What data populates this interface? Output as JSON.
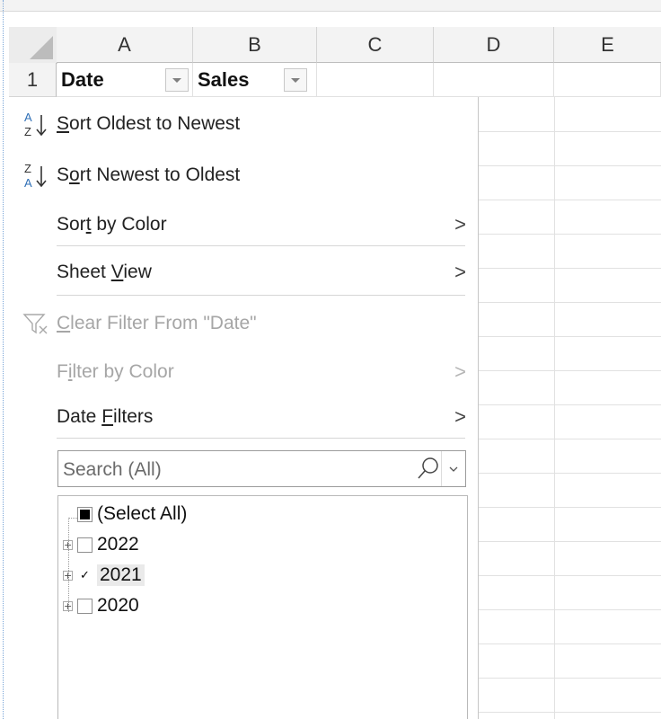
{
  "columns": [
    "A",
    "B",
    "C",
    "D",
    "E"
  ],
  "row_number": "1",
  "cells": {
    "a1": "Date",
    "b1": "Sales"
  },
  "menu": {
    "sort_asc": {
      "prefix": "",
      "mnemonic": "S",
      "rest": "ort Oldest to Newest",
      "icon_top": "A",
      "icon_bottom": "Z"
    },
    "sort_desc": {
      "prefix": "S",
      "mnemonic": "o",
      "rest": "rt Newest to Oldest",
      "icon_top": "Z",
      "icon_bottom": "A"
    },
    "sort_color": {
      "prefix": "Sor",
      "mnemonic": "t",
      "rest": " by Color"
    },
    "sheet_view": {
      "prefix": "Sheet ",
      "mnemonic": "V",
      "rest": "iew"
    },
    "clear_filter": {
      "prefix": "",
      "mnemonic": "C",
      "rest": "lear Filter From \"Date\""
    },
    "filter_color": {
      "prefix": "F",
      "mnemonic": "i",
      "rest": "lter by Color"
    },
    "date_filters": {
      "prefix": "Date ",
      "mnemonic": "F",
      "rest": "ilters"
    },
    "chevron": ">"
  },
  "search": {
    "placeholder": "Search (All)"
  },
  "tree": {
    "select_all": "(Select All)",
    "years": [
      {
        "label": "2022",
        "checked": false
      },
      {
        "label": "2021",
        "checked": true
      },
      {
        "label": "2020",
        "checked": false
      }
    ],
    "expander": "+",
    "check_glyph": "✓"
  },
  "colors": {
    "accent": "#2f6fb6",
    "disabled": "#a6a6a6",
    "grid": "#e1e1e1"
  }
}
